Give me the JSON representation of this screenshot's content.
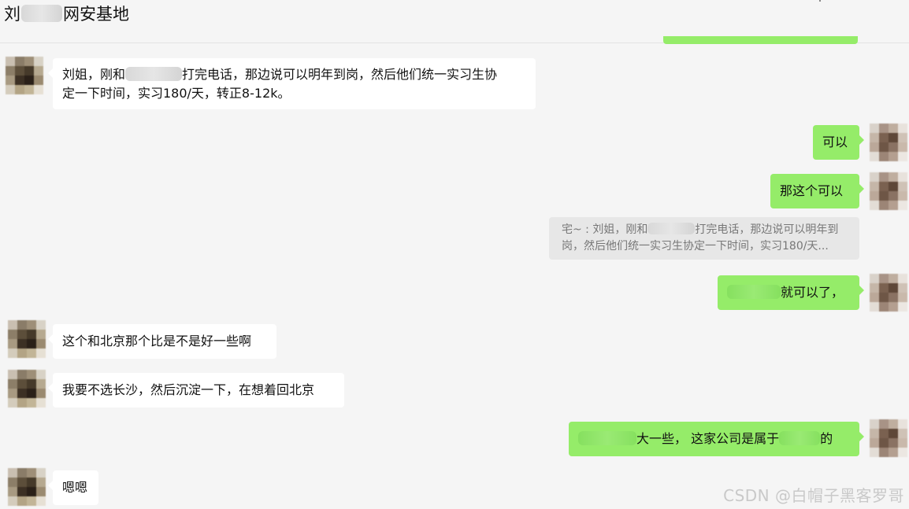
{
  "header": {
    "title_prefix": "刘",
    "title_suffix": "网安基地"
  },
  "messages": [
    {
      "side": "left",
      "line1_pre": "刘姐，刚和",
      "line1_post": "打完电话，那边说可以明年到岗，然后他们统一实习生协",
      "line2": "定一下时间，实习180/天，转正8-12k。"
    },
    {
      "side": "right",
      "text": "可以"
    },
    {
      "side": "right",
      "text": "那这个可以"
    },
    {
      "side": "right",
      "text_post": "就可以了，"
    },
    {
      "side": "left",
      "text": "这个和北京那个比是不是好一些啊"
    },
    {
      "side": "left",
      "text": "我要不选长沙，然后沉淀一下，在想着回北京"
    },
    {
      "side": "right",
      "text_mid": "大一些，  这家公司是属于",
      "text_post": "的"
    },
    {
      "side": "left",
      "text": "嗯嗯"
    }
  ],
  "quote": {
    "line1_pre": "宅~ : 刘姐，刚和",
    "line1_post": "打完电话，那边说可以明年到",
    "line2": "岗，然后他们统一实习生协定一下时间，实习180/天..."
  },
  "watermark": "CSDN @白帽子黑客罗哥",
  "colors": {
    "background": "#f5f5f5",
    "bubble_self": "#95ec69",
    "bubble_other": "#ffffff",
    "quote_bg": "#e7e7e7"
  }
}
